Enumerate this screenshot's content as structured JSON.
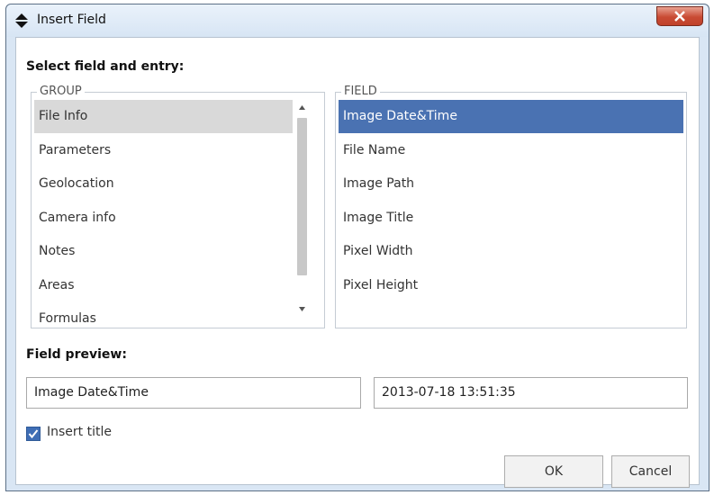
{
  "window": {
    "title": "Insert Field",
    "icon": "diamond-arrows-icon",
    "close_icon": "close-icon"
  },
  "select_label": "Select field and entry:",
  "group": {
    "legend": "GROUP",
    "items": [
      "File Info",
      "Parameters",
      "Geolocation",
      "Camera info",
      "Notes",
      "Areas",
      "Formulas"
    ],
    "selected": "File Info"
  },
  "field": {
    "legend": "FIELD",
    "items": [
      "Image Date&Time",
      "File Name",
      "Image Path",
      "Image Title",
      "Pixel Width",
      "Pixel Height"
    ],
    "selected": "Image Date&Time"
  },
  "preview": {
    "label": "Field preview:",
    "name_value": "Image Date&Time",
    "value_value": "2013-07-18 13:51:35"
  },
  "insert_title": {
    "label": "Insert title",
    "checked": true
  },
  "buttons": {
    "ok": "OK",
    "cancel": "Cancel"
  },
  "colors": {
    "selection_blue": "#4a72b2",
    "selection_gray": "#d9d9d9",
    "frame": "#d9e6f4",
    "close_red": "#c94b34"
  }
}
